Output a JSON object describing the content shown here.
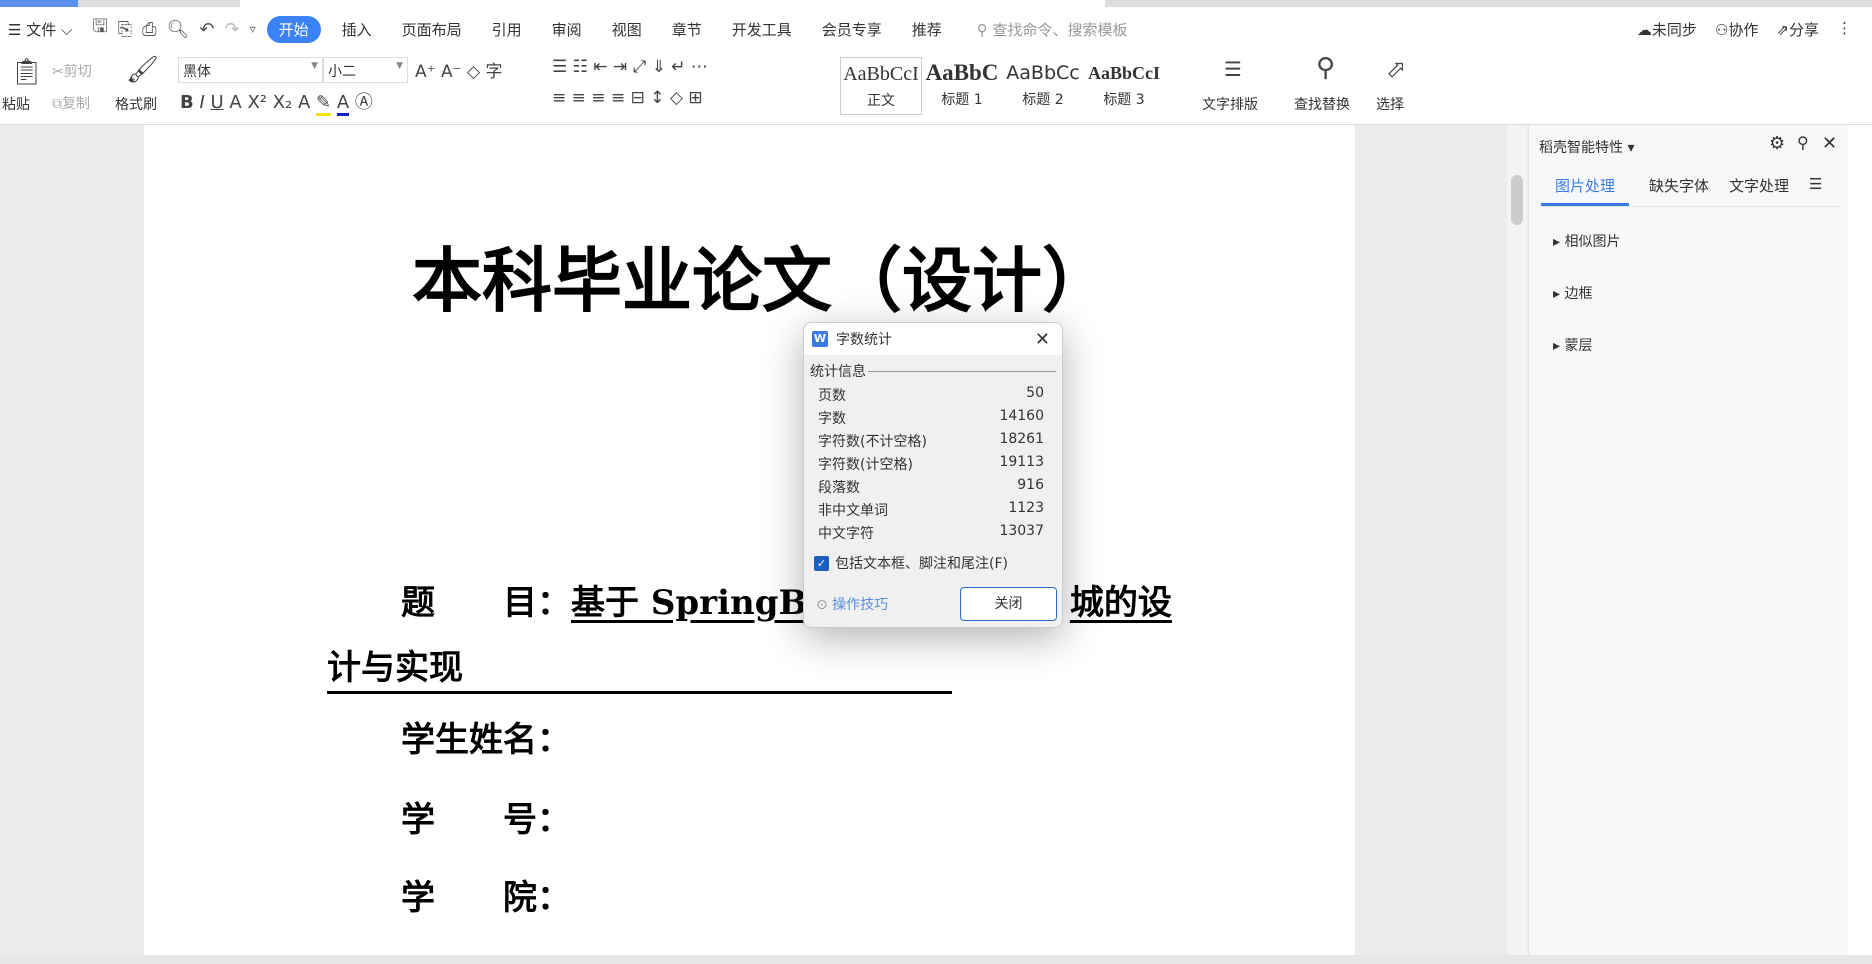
{
  "menu": {
    "file": "文件",
    "tabs": [
      "开始",
      "插入",
      "页面布局",
      "引用",
      "审阅",
      "视图",
      "章节",
      "开发工具",
      "会员专享",
      "推荐"
    ],
    "search_placeholder": "查找命令、搜索模板",
    "sync": "未同步",
    "collab": "协作",
    "share": "分享"
  },
  "ribbon": {
    "paste": "粘贴",
    "cut": "剪切",
    "copy": "复制",
    "format_painter": "格式刷",
    "font": "黑体",
    "size": "小二",
    "styles": [
      {
        "sample": "AaBbCcI",
        "label": "正文"
      },
      {
        "sample": "AaBbC",
        "label": "标题 1"
      },
      {
        "sample": "AaBbCc",
        "label": "标题 2"
      },
      {
        "sample": "AaBbCcI",
        "label": "标题 3"
      }
    ],
    "text_layout": "文字排版",
    "find_replace": "查找替换",
    "select": "选择"
  },
  "document": {
    "title": "本科毕业论文（设计）",
    "topic_label": "题　　目：",
    "topic_value_start": "基于 SpringBo",
    "topic_value_end": "城的设",
    "topic_line2": "计与实现",
    "student_name": "学生姓名：",
    "student_id": "学　　号：",
    "college": "学　　院："
  },
  "panel": {
    "title": "稻壳智能特性",
    "tabs": [
      "图片处理",
      "缺失字体",
      "文字处理"
    ],
    "items": [
      "相似图片",
      "边框",
      "蒙层"
    ]
  },
  "dialog": {
    "title": "字数统计",
    "section": "统计信息",
    "stats": [
      {
        "label": "页数",
        "value": "50"
      },
      {
        "label": "字数",
        "value": "14160"
      },
      {
        "label": "字符数(不计空格)",
        "value": "18261"
      },
      {
        "label": "字符数(计空格)",
        "value": "19113"
      },
      {
        "label": "段落数",
        "value": "916"
      },
      {
        "label": "非中文单词",
        "value": "1123"
      },
      {
        "label": "中文字符",
        "value": "13037"
      }
    ],
    "checkbox_label": "包括文本框、脚注和尾注(F)",
    "checkbox_checked": true,
    "tips": "操作技巧",
    "close": "关闭"
  }
}
